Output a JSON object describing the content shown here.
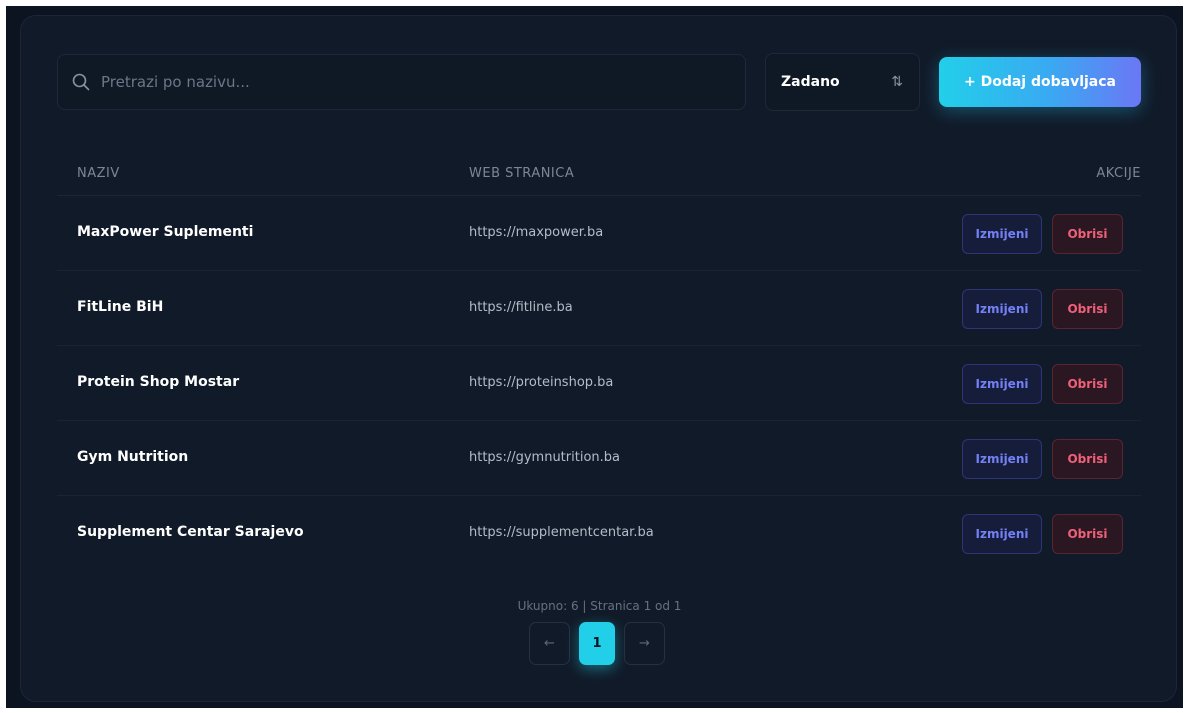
{
  "search": {
    "placeholder": "Pretrazi po nazivu...",
    "value": "",
    "icon": "search-icon"
  },
  "sort": {
    "label": "Zadano",
    "icon": "sort-arrows-icon"
  },
  "add_button": {
    "label": "+ Dodaj dobavljaca"
  },
  "table": {
    "columns": {
      "name": "NAZIV",
      "web": "WEB STRANICA",
      "actions": "AKCIJE"
    },
    "rows": [
      {
        "name": "MaxPower Suplementi",
        "web": "https://maxpower.ba",
        "edit": "Izmijeni",
        "delete": "Obrisi"
      },
      {
        "name": "FitLine BiH",
        "web": "https://fitline.ba",
        "edit": "Izmijeni",
        "delete": "Obrisi"
      },
      {
        "name": "Protein Shop Mostar",
        "web": "https://proteinshop.ba",
        "edit": "Izmijeni",
        "delete": "Obrisi"
      },
      {
        "name": "Gym Nutrition",
        "web": "https://gymnutrition.ba",
        "edit": "Izmijeni",
        "delete": "Obrisi"
      },
      {
        "name": "Supplement Centar Sarajevo",
        "web": "https://supplementcentar.ba",
        "edit": "Izmijeni",
        "delete": "Obrisi"
      }
    ]
  },
  "pagination": {
    "summary": "Ukupno: 6 | Stranica 1 od 1",
    "prev": "←",
    "current": "1",
    "next": "→"
  },
  "colors": {
    "background": "#0d1421",
    "accent": "#22cfe9",
    "edit": "#7480f5",
    "delete": "#f0607a"
  }
}
